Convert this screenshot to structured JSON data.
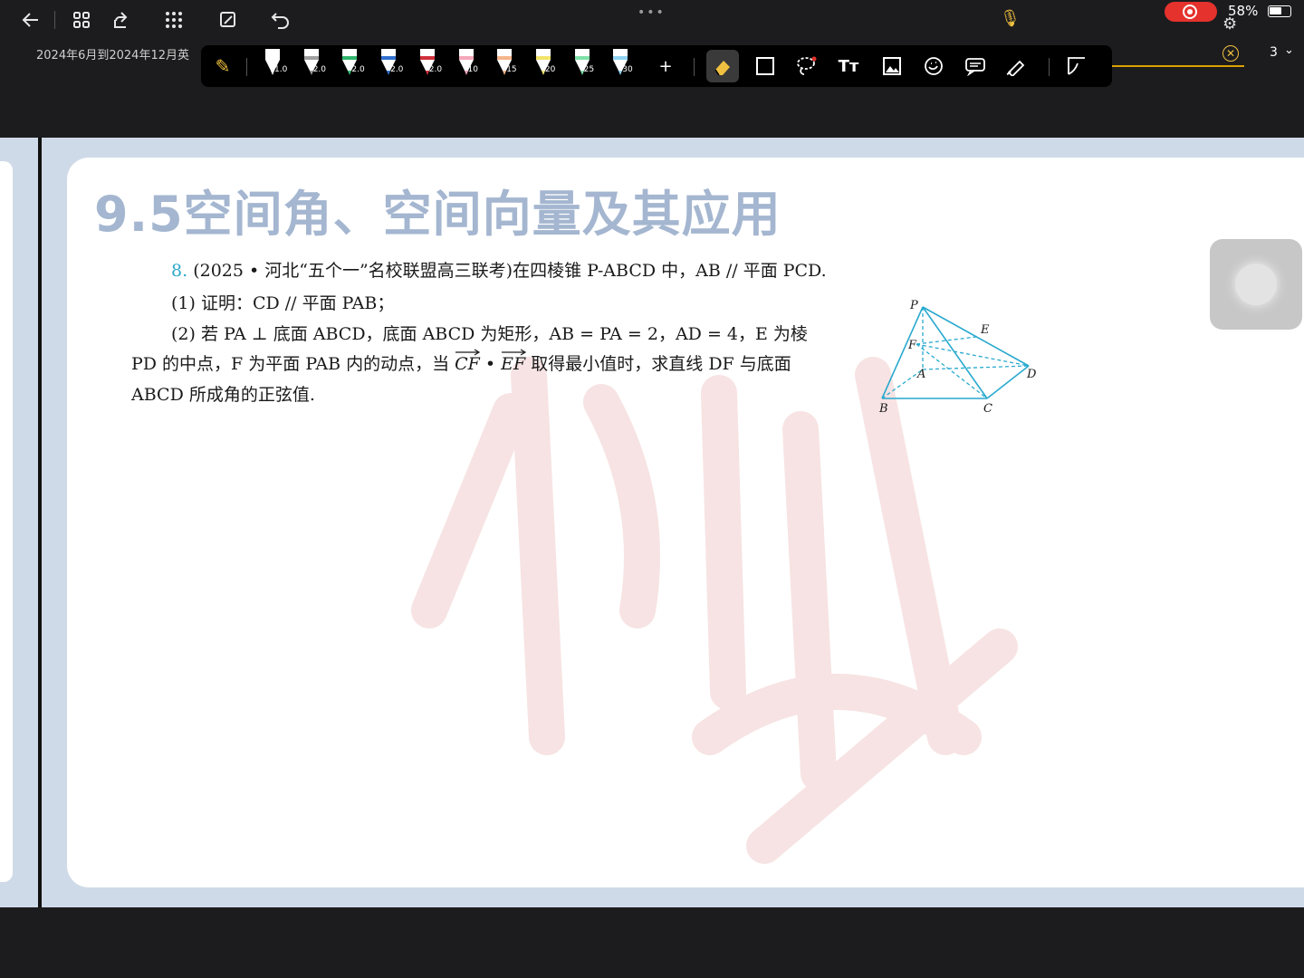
{
  "status": {
    "battery_text": "58%",
    "battery_level_percent": 58,
    "record_color": "#e5322d"
  },
  "document": {
    "title": "2024年6月到2024年12月英",
    "page_number": "3"
  },
  "toolbar": {
    "accent_color": "#f0c040",
    "pens": [
      {
        "size": "1.0",
        "color": "#ffffff"
      },
      {
        "size": "2.0",
        "color": "#9e9e9e"
      },
      {
        "size": "2.0",
        "color": "#2fb56b"
      },
      {
        "size": "2.0",
        "color": "#2f6fd0"
      },
      {
        "size": "2.0",
        "color": "#d02f3b"
      },
      {
        "size": "10",
        "color": "#f4a6b8"
      },
      {
        "size": "15",
        "color": "#f6b48a"
      },
      {
        "size": "20",
        "color": "#f2e36a"
      },
      {
        "size": "25",
        "color": "#7fe0a8"
      },
      {
        "size": "30",
        "color": "#8fd3f0"
      }
    ],
    "add_label": "+",
    "text_tool_label": "Tт",
    "tools": [
      "eraser-icon",
      "shape-icon",
      "lasso-icon",
      "text-icon",
      "image-icon",
      "sticker-icon",
      "comment-icon",
      "laser-icon",
      "page-curl-icon"
    ]
  },
  "page": {
    "heading": "9.5空间角、空间向量及其应用",
    "heading_color": "#a4b6d0",
    "question": {
      "number": "8.",
      "source_line": "(2025 • 河北“五个一”名校联盟高三联考)在四棱锥 P-ABCD 中，AB // 平面 PCD.",
      "part1": "(1) 证明：CD // 平面 PAB；",
      "part2_line1": "(2) 若 PA ⊥ 底面 ABCD，底面 ABCD 为矩形，AB = PA = 2，AD = 4，E 为棱",
      "part2_line2_pre": "PD 的中点，F 为平面 PAB 内的动点，当",
      "part2_vec1": "CF",
      "part2_dot": " • ",
      "part2_vec2": "EF",
      "part2_line2_post": " 取得最小值时，求直线 DF 与底面",
      "part2_line3": "ABCD 所成角的正弦值."
    },
    "figure_labels": {
      "P": "P",
      "E": "E",
      "F": "F",
      "A": "A",
      "D": "D",
      "B": "B",
      "C": "C"
    },
    "figure_color": "#29a9cf"
  }
}
